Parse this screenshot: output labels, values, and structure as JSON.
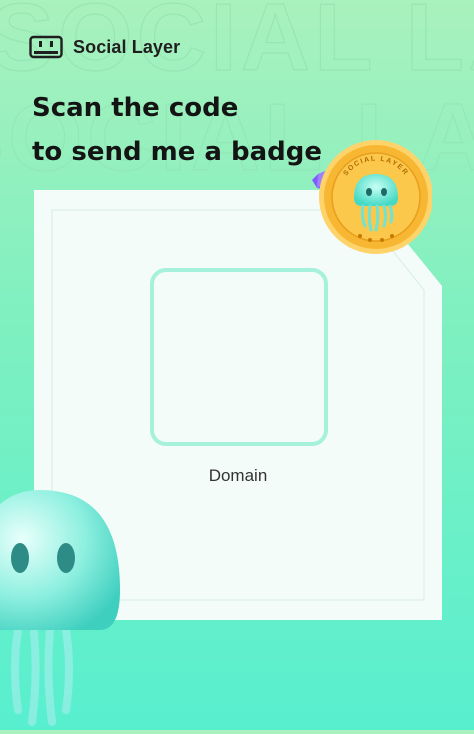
{
  "brand": {
    "name": "Social Layer",
    "icon": "ticket-icon"
  },
  "watermark": {
    "text": "SOCIAL LAYER"
  },
  "headline": {
    "line1": "Scan the code",
    "line2": "to send me a badge"
  },
  "qr": {
    "label": "Domain"
  },
  "badge": {
    "text": "SOCIAL LAYER",
    "icon": "jellyfish-badge-icon"
  },
  "colors": {
    "background_top": "#a9f1bd",
    "background_bottom": "#58efcf",
    "card": "#f4fcfa",
    "qr_border": "#a5f1d9",
    "badge_gold": "#f7b733",
    "text": "#141414"
  }
}
